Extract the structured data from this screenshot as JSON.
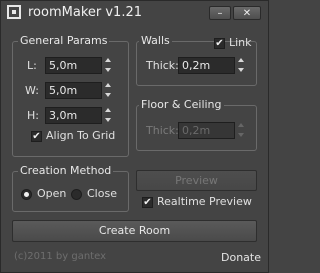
{
  "window": {
    "title": "roomMaker v1.21",
    "minimize_glyph": "–",
    "close_glyph": "✕"
  },
  "general_params": {
    "title": "General Params",
    "length": {
      "label": "L:",
      "value": "5,0m"
    },
    "width": {
      "label": "W:",
      "value": "5,0m"
    },
    "height": {
      "label": "H:",
      "value": "3,0m"
    },
    "align_to_grid": {
      "label": "Align To Grid",
      "checked": true
    }
  },
  "walls": {
    "title": "Walls",
    "link": {
      "label": "Link",
      "checked": true
    },
    "thickness": {
      "label": "Thick:",
      "value": "0,2m"
    }
  },
  "floor_ceiling": {
    "title": "Floor & Ceiling",
    "thickness": {
      "label": "Thick:",
      "value": "0,2m",
      "enabled": false
    }
  },
  "creation_method": {
    "title": "Creation Method",
    "options": [
      {
        "label": "Open",
        "selected": true
      },
      {
        "label": "Close",
        "selected": false
      }
    ]
  },
  "preview": {
    "button_label": "Preview",
    "enabled": false
  },
  "realtime_preview": {
    "label": "Realtime Preview",
    "checked": true
  },
  "create_room_label": "Create Room",
  "footer": {
    "copyright": "(c)2011 by gantex",
    "donate_label": "Donate"
  },
  "colors": {
    "background": "#444444",
    "field": "#2b2b2b",
    "text": "#dcdcdc",
    "disabled_text": "#777777"
  }
}
